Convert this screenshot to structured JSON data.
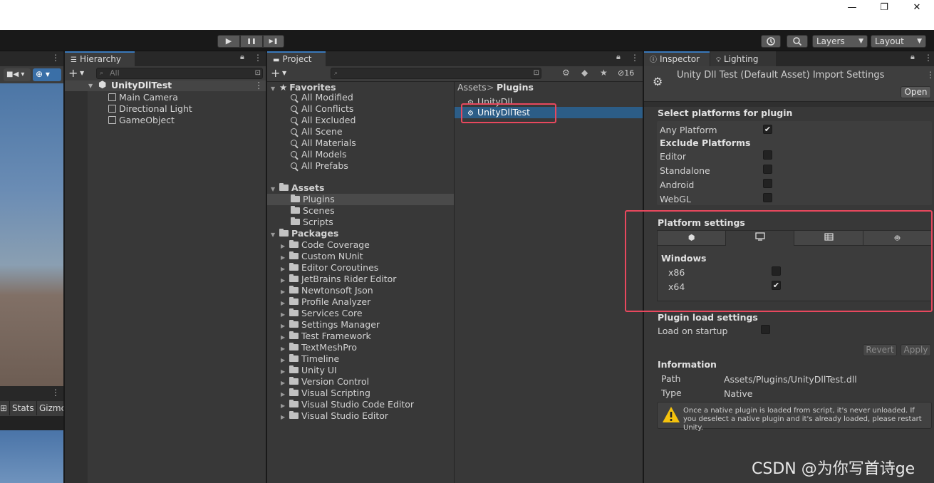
{
  "window": {
    "minimize": "—",
    "maximize": "❐",
    "close": "✕"
  },
  "toolbar": {
    "play": "▶",
    "pause": "❚❚",
    "step": "▶❚",
    "layers": "Layers",
    "layout": "Layout"
  },
  "scene": {
    "stats": "Stats",
    "gizmos": "Gizmc"
  },
  "hierarchy": {
    "tab": "Hierarchy",
    "search_placeholder": "All",
    "root": "UnityDllTest",
    "items": [
      "Main Camera",
      "Directional Light",
      "GameObject"
    ]
  },
  "project": {
    "tab": "Project",
    "hidden_count": "16",
    "favorites_label": "Favorites",
    "favorites": [
      "All Modified",
      "All Conflicts",
      "All Excluded",
      "All Scene",
      "All Materials",
      "All Models",
      "All Prefabs"
    ],
    "assets_label": "Assets",
    "assets": [
      "Plugins",
      "Scenes",
      "Scripts"
    ],
    "packages_label": "Packages",
    "packages": [
      "Code Coverage",
      "Custom NUnit",
      "Editor Coroutines",
      "JetBrains Rider Editor",
      "Newtonsoft Json",
      "Profile Analyzer",
      "Services Core",
      "Settings Manager",
      "Test Framework",
      "TextMeshPro",
      "Timeline",
      "Unity UI",
      "Version Control",
      "Visual Scripting",
      "Visual Studio Code Editor",
      "Visual Studio Editor"
    ],
    "breadcrumb": {
      "root": "Assets",
      "sep": ">",
      "current": "Plugins"
    },
    "files": [
      "UnityDll",
      "UnityDllTest"
    ]
  },
  "inspector": {
    "tab": "Inspector",
    "lighting_tab": "Lighting",
    "title": "Unity Dll Test (Default Asset) Import Settings",
    "open": "Open",
    "select_platforms": "Select platforms for plugin",
    "any_platform": "Any Platform",
    "exclude_platforms": "Exclude Platforms",
    "platforms": [
      "Editor",
      "Standalone",
      "Android",
      "WebGL"
    ],
    "platform_settings": "Platform settings",
    "windows": "Windows",
    "x86": "x86",
    "x64": "x64",
    "plugin_load_settings": "Plugin load settings",
    "load_on_startup": "Load on startup",
    "revert": "Revert",
    "apply": "Apply",
    "information": "Information",
    "path_label": "Path",
    "path_value": "Assets/Plugins/UnityDllTest.dll",
    "type_label": "Type",
    "type_value": "Native",
    "warning": "Once a native plugin is loaded from script, it's never unloaded. If you deselect a native plugin and it's already loaded, please restart Unity."
  },
  "watermark": "CSDN @为你写首诗ge",
  "colors": {
    "accent": "#3a79bb",
    "highlight": "#e8485e",
    "selection": "#2c5d87"
  }
}
